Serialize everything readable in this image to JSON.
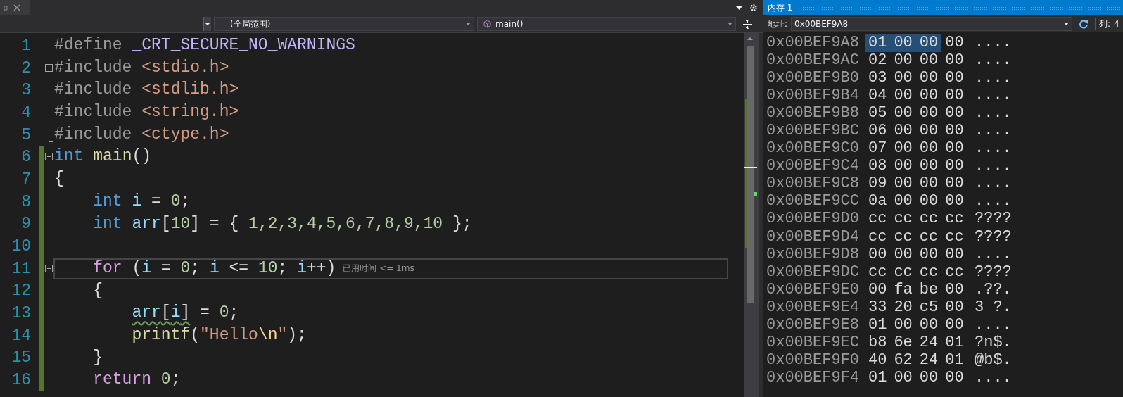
{
  "navigation_bar": {
    "scope": "(全局范围)",
    "member": "main()"
  },
  "code_lines": [
    {
      "number": "1",
      "kind": "plain",
      "changed": false,
      "current": false,
      "tokens": [
        {
          "text": "#define ",
          "kind": "preproc"
        },
        {
          "text": "_CRT_SECURE_NO_WARNINGS",
          "kind": "macro"
        }
      ]
    },
    {
      "number": "2",
      "kind": "foldstart",
      "changed": false,
      "current": false,
      "tokens": [
        {
          "text": "#include ",
          "kind": "preproc"
        },
        {
          "text": "<stdio.h>",
          "kind": "header"
        }
      ]
    },
    {
      "number": "3",
      "kind": "foldinner",
      "changed": false,
      "current": false,
      "tokens": [
        {
          "text": "#include ",
          "kind": "preproc"
        },
        {
          "text": "<stdlib.h>",
          "kind": "header"
        }
      ]
    },
    {
      "number": "4",
      "kind": "foldinner",
      "changed": false,
      "current": false,
      "tokens": [
        {
          "text": "#include ",
          "kind": "preproc"
        },
        {
          "text": "<string.h>",
          "kind": "header"
        }
      ]
    },
    {
      "number": "5",
      "kind": "foldend",
      "changed": false,
      "current": false,
      "tokens": [
        {
          "text": "#include ",
          "kind": "preproc"
        },
        {
          "text": "<ctype.h>",
          "kind": "header"
        }
      ]
    },
    {
      "number": "6",
      "kind": "foldstart",
      "changed": true,
      "current": false,
      "tokens": [
        {
          "text": "int ",
          "kind": "keyword"
        },
        {
          "text": "main",
          "kind": "function"
        },
        {
          "text": "()",
          "kind": "plain"
        }
      ]
    },
    {
      "number": "7",
      "kind": "foldinner",
      "changed": true,
      "current": false,
      "tokens": [
        {
          "text": "{",
          "kind": "plain"
        }
      ]
    },
    {
      "number": "8",
      "kind": "foldinner",
      "changed": true,
      "current": false,
      "tokens": [
        {
          "text": "    int ",
          "kind": "keyword"
        },
        {
          "text": "i",
          "kind": "variable"
        },
        {
          "text": " = ",
          "kind": "plain"
        },
        {
          "text": "0",
          "kind": "number"
        },
        {
          "text": ";",
          "kind": "plain"
        }
      ]
    },
    {
      "number": "9",
      "kind": "foldinner",
      "changed": true,
      "current": false,
      "tokens": [
        {
          "text": "    int ",
          "kind": "keyword"
        },
        {
          "text": "arr",
          "kind": "variable"
        },
        {
          "text": "[",
          "kind": "plain"
        },
        {
          "text": "10",
          "kind": "number"
        },
        {
          "text": "] = { ",
          "kind": "plain"
        },
        {
          "text": "1,2,3,4,5,6,7,8,9,10",
          "kind": "number"
        },
        {
          "text": " };",
          "kind": "plain"
        }
      ]
    },
    {
      "number": "10",
      "kind": "foldinner",
      "changed": true,
      "current": false
    },
    {
      "number": "11",
      "kind": "foldstart",
      "changed": true,
      "current": true,
      "hint": "已用时间 <= 1ms",
      "tokens": [
        {
          "text": "    for",
          "kind": "control"
        },
        {
          "text": " (",
          "kind": "plain"
        },
        {
          "text": "i",
          "kind": "variable"
        },
        {
          "text": " = ",
          "kind": "plain"
        },
        {
          "text": "0",
          "kind": "number"
        },
        {
          "text": "; ",
          "kind": "plain"
        },
        {
          "text": "i",
          "kind": "variable"
        },
        {
          "text": " <= ",
          "kind": "plain"
        },
        {
          "text": "10",
          "kind": "number"
        },
        {
          "text": "; ",
          "kind": "plain"
        },
        {
          "text": "i",
          "kind": "variable"
        },
        {
          "text": "++)",
          "kind": "plain"
        }
      ]
    },
    {
      "number": "12",
      "kind": "foldinner",
      "changed": true,
      "current": false,
      "tokens": [
        {
          "text": "    {",
          "kind": "plain"
        }
      ]
    },
    {
      "number": "13",
      "kind": "foldinner",
      "changed": true,
      "current": false,
      "tokens": [
        {
          "kind": "warning",
          "children": [
            {
              "text": "        arr",
              "kind": "variable"
            },
            {
              "text": "[",
              "kind": "plain"
            },
            {
              "text": "i",
              "kind": "variable"
            },
            {
              "text": "]",
              "kind": "plain"
            }
          ]
        },
        {
          "text": " = ",
          "kind": "plain"
        },
        {
          "text": "0",
          "kind": "number"
        },
        {
          "text": ";",
          "kind": "plain"
        }
      ]
    },
    {
      "number": "14",
      "kind": "foldinner",
      "changed": true,
      "current": false,
      "tokens": [
        {
          "text": "        printf",
          "kind": "function"
        },
        {
          "text": "(",
          "kind": "plain"
        },
        {
          "text": "\"Hello",
          "kind": "string"
        },
        {
          "text": "\\n",
          "kind": "escape"
        },
        {
          "text": "\"",
          "kind": "string"
        },
        {
          "text": ");",
          "kind": "plain"
        }
      ]
    },
    {
      "number": "15",
      "kind": "foldend",
      "changed": true,
      "current": false,
      "tokens": [
        {
          "text": "    }",
          "kind": "plain"
        }
      ]
    },
    {
      "number": "16",
      "kind": "foldinner",
      "changed": true,
      "current": false,
      "tokens": [
        {
          "text": "    return ",
          "kind": "control"
        },
        {
          "text": "0",
          "kind": "number"
        },
        {
          "text": ";",
          "kind": "plain"
        }
      ]
    }
  ],
  "memory": {
    "title": "内存 1",
    "address_label": "地址:",
    "address": "0x00BEF9A8",
    "columns_label": "列:",
    "columns": "4",
    "rows": [
      {
        "address": "0x00BEF9A8",
        "bytes": [
          {
            "value": "01",
            "selected": true
          },
          {
            "value": "00",
            "selected": true
          },
          {
            "value": "00",
            "selected": true
          },
          {
            "value": "00",
            "selected": false
          }
        ],
        "ascii": "...."
      },
      {
        "address": "0x00BEF9AC",
        "bytes": [
          {
            "value": "02",
            "selected": false
          },
          {
            "value": "00",
            "selected": false
          },
          {
            "value": "00",
            "selected": false
          },
          {
            "value": "00",
            "selected": false
          }
        ],
        "ascii": "...."
      },
      {
        "address": "0x00BEF9B0",
        "bytes": [
          {
            "value": "03",
            "selected": false
          },
          {
            "value": "00",
            "selected": false
          },
          {
            "value": "00",
            "selected": false
          },
          {
            "value": "00",
            "selected": false
          }
        ],
        "ascii": "...."
      },
      {
        "address": "0x00BEF9B4",
        "bytes": [
          {
            "value": "04",
            "selected": false
          },
          {
            "value": "00",
            "selected": false
          },
          {
            "value": "00",
            "selected": false
          },
          {
            "value": "00",
            "selected": false
          }
        ],
        "ascii": "...."
      },
      {
        "address": "0x00BEF9B8",
        "bytes": [
          {
            "value": "05",
            "selected": false
          },
          {
            "value": "00",
            "selected": false
          },
          {
            "value": "00",
            "selected": false
          },
          {
            "value": "00",
            "selected": false
          }
        ],
        "ascii": "...."
      },
      {
        "address": "0x00BEF9BC",
        "bytes": [
          {
            "value": "06",
            "selected": false
          },
          {
            "value": "00",
            "selected": false
          },
          {
            "value": "00",
            "selected": false
          },
          {
            "value": "00",
            "selected": false
          }
        ],
        "ascii": "...."
      },
      {
        "address": "0x00BEF9C0",
        "bytes": [
          {
            "value": "07",
            "selected": false
          },
          {
            "value": "00",
            "selected": false
          },
          {
            "value": "00",
            "selected": false
          },
          {
            "value": "00",
            "selected": false
          }
        ],
        "ascii": "...."
      },
      {
        "address": "0x00BEF9C4",
        "bytes": [
          {
            "value": "08",
            "selected": false
          },
          {
            "value": "00",
            "selected": false
          },
          {
            "value": "00",
            "selected": false
          },
          {
            "value": "00",
            "selected": false
          }
        ],
        "ascii": "...."
      },
      {
        "address": "0x00BEF9C8",
        "bytes": [
          {
            "value": "09",
            "selected": false
          },
          {
            "value": "00",
            "selected": false
          },
          {
            "value": "00",
            "selected": false
          },
          {
            "value": "00",
            "selected": false
          }
        ],
        "ascii": "...."
      },
      {
        "address": "0x00BEF9CC",
        "bytes": [
          {
            "value": "0a",
            "selected": false
          },
          {
            "value": "00",
            "selected": false
          },
          {
            "value": "00",
            "selected": false
          },
          {
            "value": "00",
            "selected": false
          }
        ],
        "ascii": "...."
      },
      {
        "address": "0x00BEF9D0",
        "bytes": [
          {
            "value": "cc",
            "selected": false
          },
          {
            "value": "cc",
            "selected": false
          },
          {
            "value": "cc",
            "selected": false
          },
          {
            "value": "cc",
            "selected": false
          }
        ],
        "ascii": "????"
      },
      {
        "address": "0x00BEF9D4",
        "bytes": [
          {
            "value": "cc",
            "selected": false
          },
          {
            "value": "cc",
            "selected": false
          },
          {
            "value": "cc",
            "selected": false
          },
          {
            "value": "cc",
            "selected": false
          }
        ],
        "ascii": "????"
      },
      {
        "address": "0x00BEF9D8",
        "bytes": [
          {
            "value": "00",
            "selected": false
          },
          {
            "value": "00",
            "selected": false
          },
          {
            "value": "00",
            "selected": false
          },
          {
            "value": "00",
            "selected": false
          }
        ],
        "ascii": "...."
      },
      {
        "address": "0x00BEF9DC",
        "bytes": [
          {
            "value": "cc",
            "selected": false
          },
          {
            "value": "cc",
            "selected": false
          },
          {
            "value": "cc",
            "selected": false
          },
          {
            "value": "cc",
            "selected": false
          }
        ],
        "ascii": "????"
      },
      {
        "address": "0x00BEF9E0",
        "bytes": [
          {
            "value": "00",
            "selected": false
          },
          {
            "value": "fa",
            "selected": false
          },
          {
            "value": "be",
            "selected": false
          },
          {
            "value": "00",
            "selected": false
          }
        ],
        "ascii": ".??."
      },
      {
        "address": "0x00BEF9E4",
        "bytes": [
          {
            "value": "33",
            "selected": false
          },
          {
            "value": "20",
            "selected": false
          },
          {
            "value": "c5",
            "selected": false
          },
          {
            "value": "00",
            "selected": false
          }
        ],
        "ascii": "3 ?."
      },
      {
        "address": "0x00BEF9E8",
        "bytes": [
          {
            "value": "01",
            "selected": false
          },
          {
            "value": "00",
            "selected": false
          },
          {
            "value": "00",
            "selected": false
          },
          {
            "value": "00",
            "selected": false
          }
        ],
        "ascii": "...."
      },
      {
        "address": "0x00BEF9EC",
        "bytes": [
          {
            "value": "b8",
            "selected": false
          },
          {
            "value": "6e",
            "selected": false
          },
          {
            "value": "24",
            "selected": false
          },
          {
            "value": "01",
            "selected": false
          }
        ],
        "ascii": "?n$."
      },
      {
        "address": "0x00BEF9F0",
        "bytes": [
          {
            "value": "40",
            "selected": false
          },
          {
            "value": "62",
            "selected": false
          },
          {
            "value": "24",
            "selected": false
          },
          {
            "value": "01",
            "selected": false
          }
        ],
        "ascii": "@b$."
      },
      {
        "address": "0x00BEF9F4",
        "bytes": [
          {
            "value": "01",
            "selected": false
          },
          {
            "value": "00",
            "selected": false
          },
          {
            "value": "00",
            "selected": false
          },
          {
            "value": "00",
            "selected": false
          }
        ],
        "ascii": "...."
      }
    ]
  }
}
